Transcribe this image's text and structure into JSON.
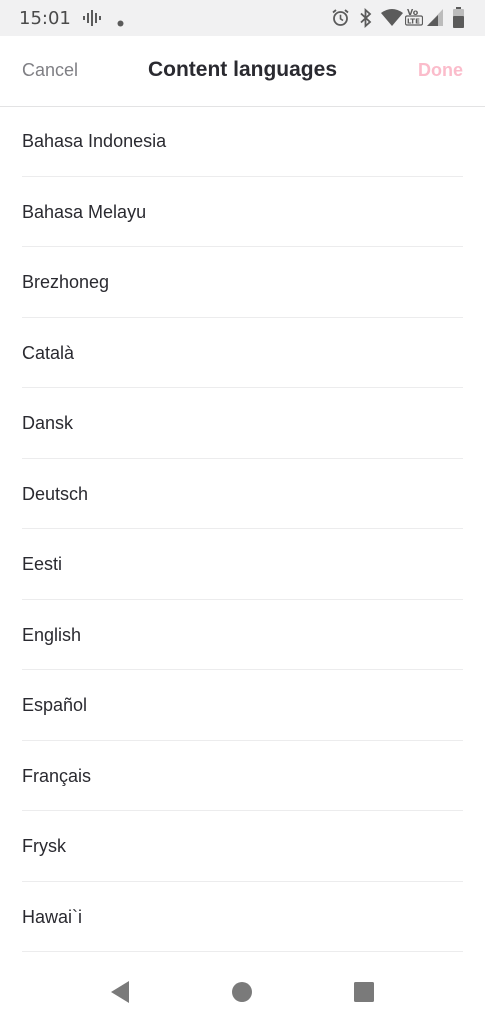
{
  "status_bar": {
    "time": "15:01",
    "icons": [
      "voice-activity-icon",
      "notification-dot-icon",
      "alarm-icon",
      "bluetooth-icon",
      "wifi-icon",
      "volte-icon",
      "cell-signal-icon",
      "battery-icon"
    ],
    "volte_label": "Vo\nLTE"
  },
  "header": {
    "cancel_label": "Cancel",
    "title": "Content languages",
    "done_label": "Done",
    "done_color": "#fbbccb"
  },
  "languages": [
    {
      "label": "Bahasa Indonesia"
    },
    {
      "label": "Bahasa Melayu"
    },
    {
      "label": "Brezhoneg"
    },
    {
      "label": "Català"
    },
    {
      "label": "Dansk"
    },
    {
      "label": "Deutsch"
    },
    {
      "label": "Eesti"
    },
    {
      "label": "English"
    },
    {
      "label": "Español"
    },
    {
      "label": "Français"
    },
    {
      "label": "Frysk"
    },
    {
      "label": "Hawai`i"
    }
  ],
  "nav_bar": {
    "icons": [
      "back-triangle-icon",
      "home-circle-icon",
      "recents-square-icon"
    ]
  }
}
